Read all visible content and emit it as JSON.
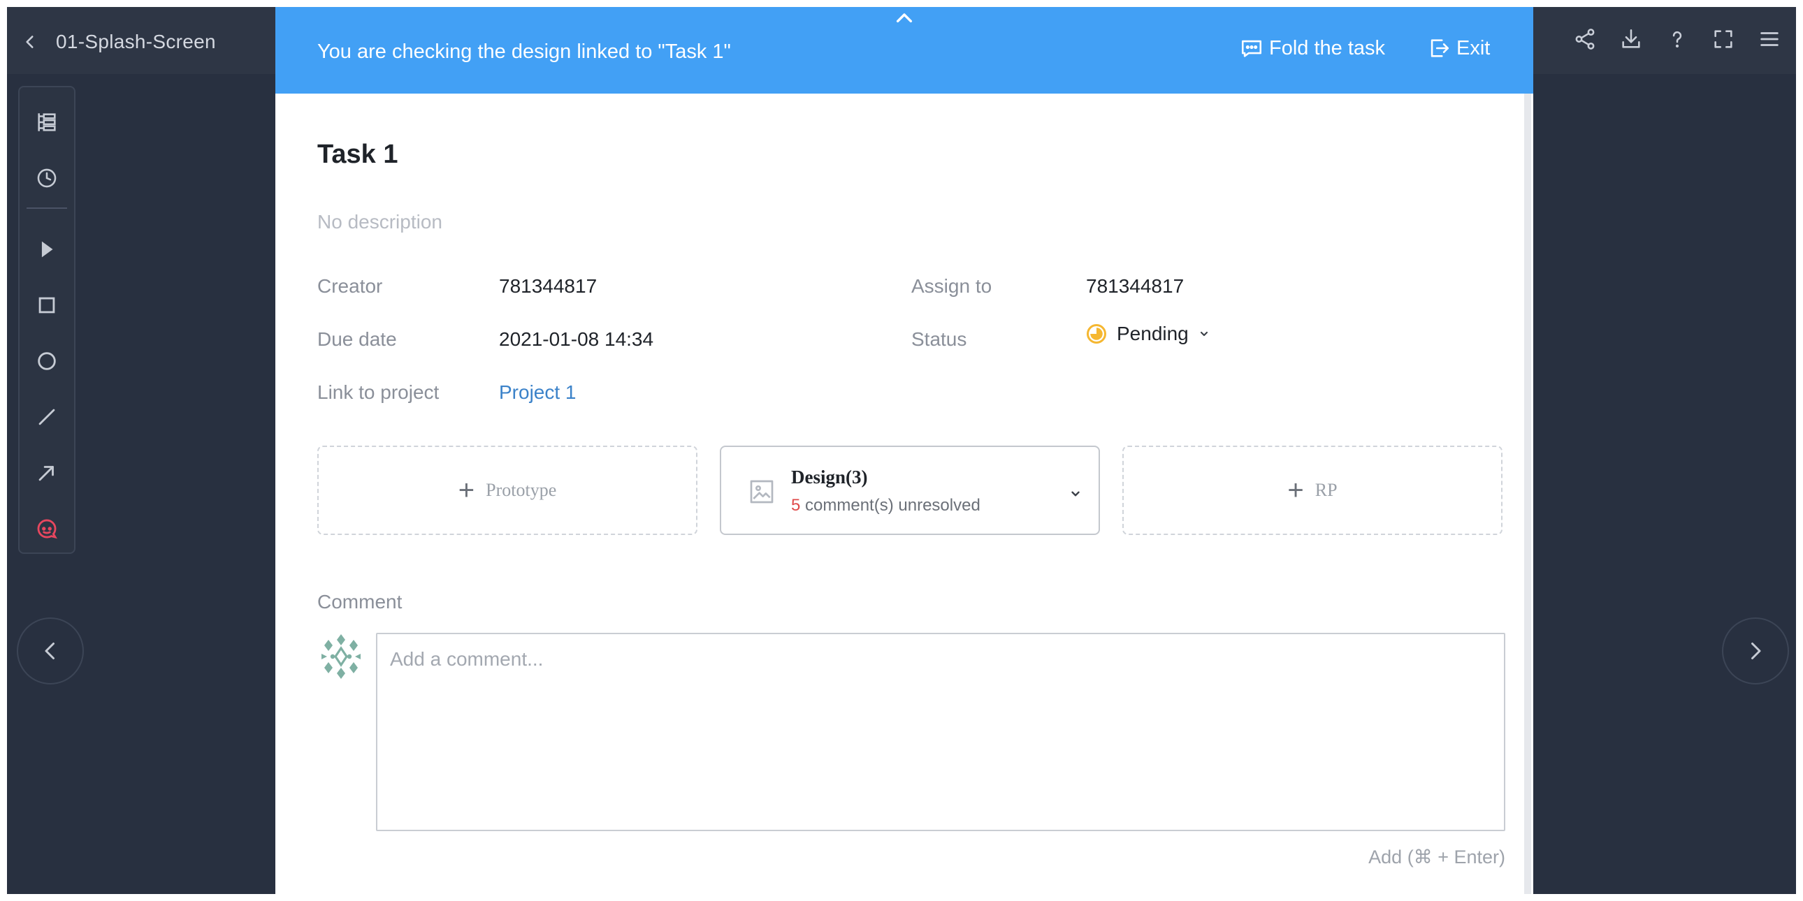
{
  "header": {
    "page_name": "01-Splash-Screen"
  },
  "banner": {
    "message": "You are checking the design linked to \"Task 1\"",
    "fold_label": "Fold the task",
    "exit_label": "Exit"
  },
  "task": {
    "title": "Task 1",
    "description": "No description",
    "fields": {
      "creator_label": "Creator",
      "creator_value": "781344817",
      "assign_label": "Assign to",
      "assign_value": "781344817",
      "due_label": "Due date",
      "due_value": "2021-01-08 14:34",
      "status_label": "Status",
      "status_value": "Pending",
      "link_label": "Link to project",
      "link_value": "Project 1"
    },
    "cards": {
      "prototype_label": "Prototype",
      "design_name": "Design(3)",
      "design_count": "5",
      "design_unresolved": "comment(s) unresolved",
      "rp_label": "RP"
    },
    "comment": {
      "label": "Comment",
      "placeholder": "Add a comment...",
      "submit_hint": "Add (⌘ + Enter)"
    }
  },
  "icons": {
    "toolbar": [
      "layers-icon",
      "history-icon",
      "pointer-icon",
      "rectangle-icon",
      "circle-icon",
      "line-icon",
      "arrow-icon",
      "comment-icon"
    ],
    "top_right": [
      "share-icon",
      "download-icon",
      "help-icon",
      "fullscreen-icon",
      "menu-icon"
    ]
  },
  "colors": {
    "banner": "#42a0f5",
    "status_pending": "#f5b731",
    "link": "#3b82c9",
    "unresolved_count": "#e04a4a",
    "comment_tool_active": "#e8475f"
  }
}
